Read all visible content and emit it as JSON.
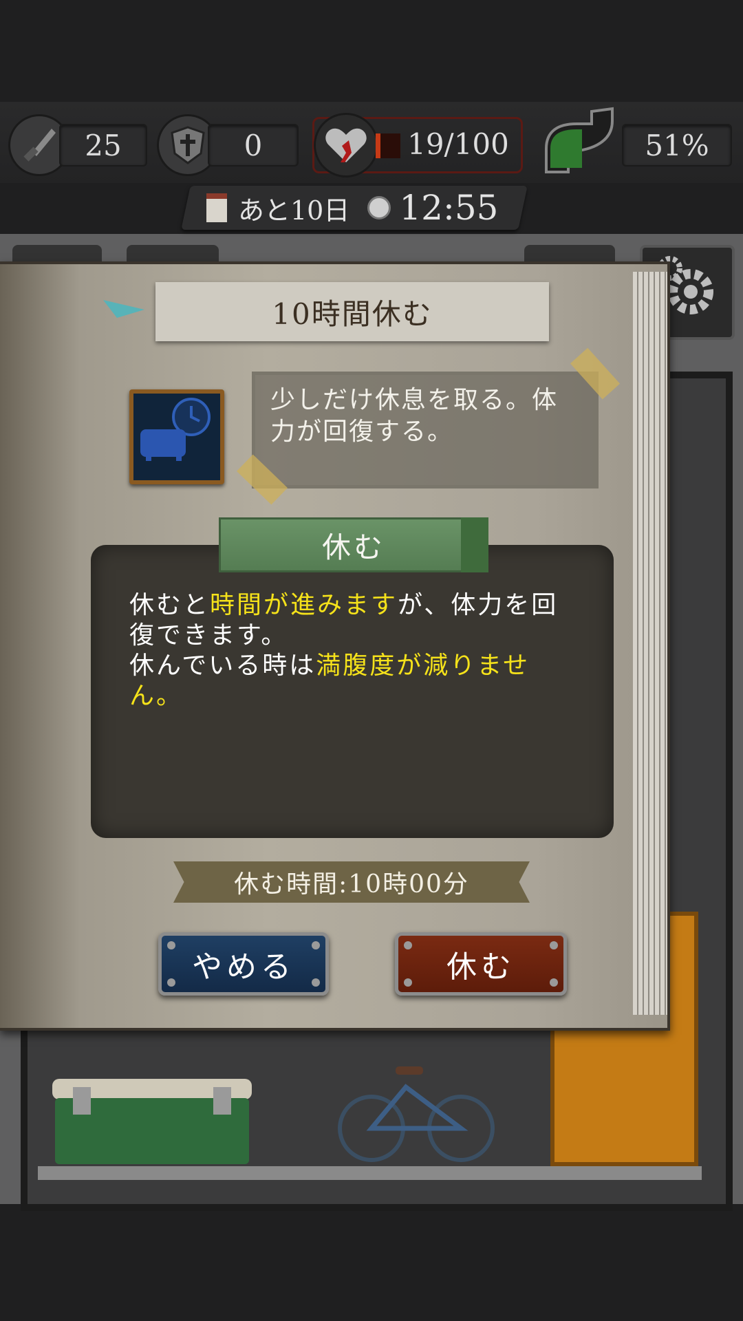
{
  "status": {
    "attack": "25",
    "defense": "0",
    "health": "19/100",
    "health_fraction": 0.19,
    "hunger": "51%",
    "hunger_fraction": 0.51
  },
  "clock": {
    "days_left": "あと10日",
    "time": "12:55"
  },
  "dialog": {
    "title": "10時間休む",
    "description": "少しだけ休息を取る。体力が回復する。",
    "tab_label": "休む",
    "detail": {
      "line1_a": "休むと",
      "line1_hl": "時間が進みます",
      "line1_b": "が、体力を回復できます。",
      "line2_a": "休んでいる時は",
      "line2_hl": "満腹度が減りません。"
    },
    "rest_time": "休む時間:10時00分",
    "cancel_label": "やめる",
    "confirm_label": "休む"
  },
  "colors": {
    "highlight": "#f5e21a",
    "health_bar": "#c63a16",
    "hunger_bar": "#2f7a2f"
  },
  "icons": [
    "knife-icon",
    "shield-icon",
    "heart-icon",
    "stomach-icon",
    "calendar-icon",
    "clock-icon",
    "settings-gear-icon",
    "sofa-clock-icon"
  ]
}
